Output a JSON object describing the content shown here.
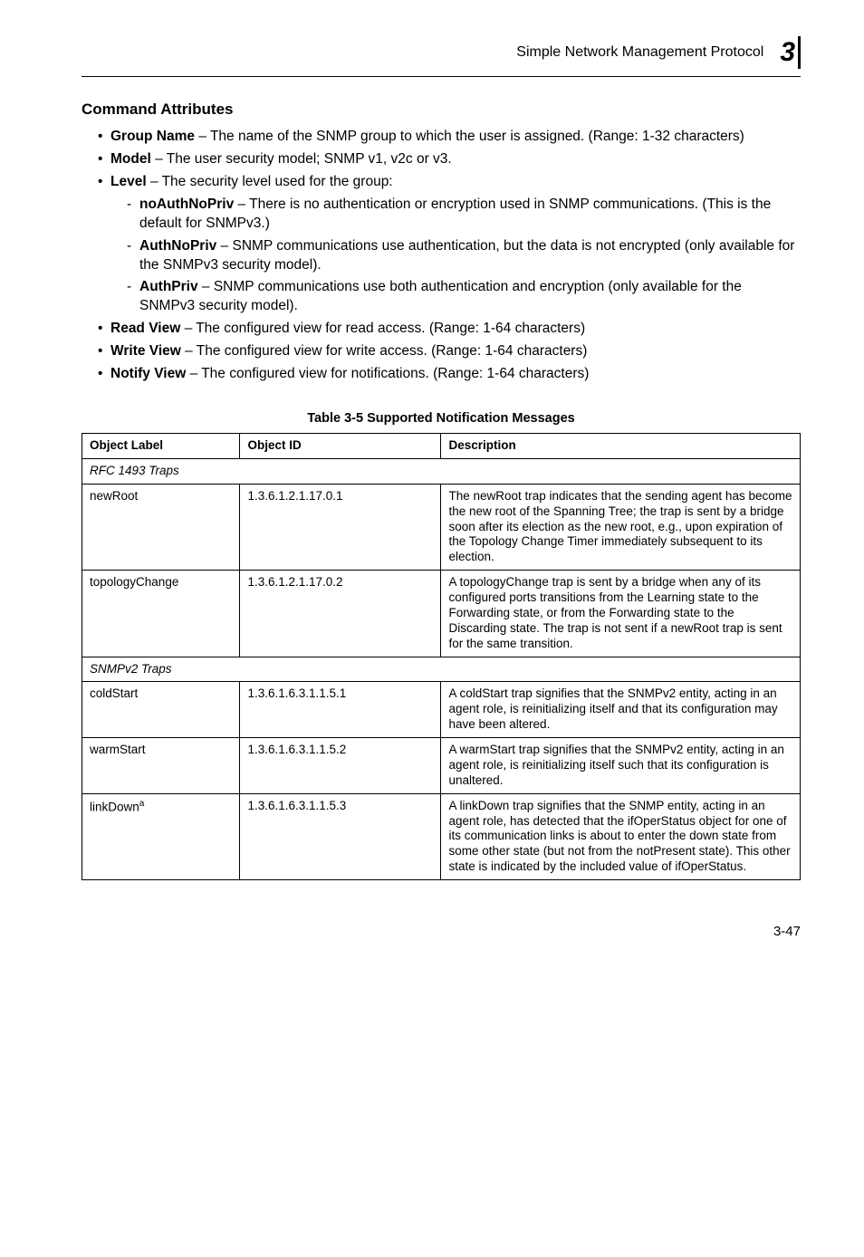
{
  "header": {
    "title": "Simple Network Management Protocol",
    "chapter": "3"
  },
  "section_heading": "Command Attributes",
  "bullets": {
    "group_name_label": "Group Name",
    "group_name_text": " – The name of the SNMP group to which the user is assigned. (Range: 1-32 characters)",
    "model_label": "Model",
    "model_text": " – The user security model; SNMP v1, v2c or v3.",
    "level_label": "Level",
    "level_text": " – The security level used for the group:",
    "noauth_label": "noAuthNoPriv",
    "noauth_text": " – There is no authentication or encryption used in SNMP communications. (This is the default for SNMPv3.)",
    "authno_label": "AuthNoPriv",
    "authno_text": " – SNMP communications use authentication, but the data is not encrypted (only available for the SNMPv3 security model).",
    "authpriv_label": "AuthPriv",
    "authpriv_text": " – SNMP communications use both authentication and encryption (only available for the SNMPv3 security model).",
    "readview_label": "Read View",
    "readview_text": " – The configured view for read access. (Range: 1-64 characters)",
    "writeview_label": "Write View",
    "writeview_text": " – The configured view for write access. (Range: 1-64 characters)",
    "notifyview_label": "Notify View",
    "notifyview_text": " – The configured view for notifications. (Range: 1-64 characters)"
  },
  "table": {
    "caption": "Table 3-5  Supported Notification Messages",
    "headers": {
      "label": "Object Label",
      "id": "Object ID",
      "desc": "Description"
    },
    "section1": "RFC 1493 Traps",
    "rows1": [
      {
        "label": "newRoot",
        "id": "1.3.6.1.2.1.17.0.1",
        "desc": "The newRoot trap indicates that the sending agent has become the new root of the Spanning Tree; the trap is sent by a bridge soon after its election as the new root, e.g., upon expiration of the Topology Change Timer immediately subsequent to its election."
      },
      {
        "label": "topologyChange",
        "id": "1.3.6.1.2.1.17.0.2",
        "desc": "A topologyChange trap is sent by a bridge when any of its configured ports transitions from the Learning state to the Forwarding state, or from the Forwarding state to the Discarding state. The trap is not sent if a newRoot trap is sent for the same transition."
      }
    ],
    "section2": "SNMPv2 Traps",
    "rows2": [
      {
        "label": "coldStart",
        "id": "1.3.6.1.6.3.1.1.5.1",
        "desc": "A coldStart trap signifies that the SNMPv2 entity, acting in an agent role, is reinitializing itself and that its configuration may have been altered."
      },
      {
        "label": "warmStart",
        "id": "1.3.6.1.6.3.1.1.5.2",
        "desc": "A warmStart trap signifies that the SNMPv2 entity, acting in an agent role, is reinitializing itself such that its configuration is unaltered."
      },
      {
        "label_prefix": "linkDown",
        "label_sup": "a",
        "id": "1.3.6.1.6.3.1.1.5.3",
        "desc": "A linkDown trap signifies that the SNMP entity, acting in an agent role, has detected that the ifOperStatus object for one of its communication links is about to enter the down state from some other state (but not from the notPresent state). This other state is indicated by the included value of ifOperStatus."
      }
    ]
  },
  "page_number": "3-47",
  "chart_data": {
    "type": "table",
    "title": "Table 3-5 Supported Notification Messages",
    "columns": [
      "Object Label",
      "Object ID",
      "Description"
    ],
    "sections": [
      {
        "name": "RFC 1493 Traps",
        "rows": [
          [
            "newRoot",
            "1.3.6.1.2.1.17.0.1",
            "The newRoot trap indicates that the sending agent has become the new root of the Spanning Tree; the trap is sent by a bridge soon after its election as the new root, e.g., upon expiration of the Topology Change Timer immediately subsequent to its election."
          ],
          [
            "topologyChange",
            "1.3.6.1.2.1.17.0.2",
            "A topologyChange trap is sent by a bridge when any of its configured ports transitions from the Learning state to the Forwarding state, or from the Forwarding state to the Discarding state. The trap is not sent if a newRoot trap is sent for the same transition."
          ]
        ]
      },
      {
        "name": "SNMPv2 Traps",
        "rows": [
          [
            "coldStart",
            "1.3.6.1.6.3.1.1.5.1",
            "A coldStart trap signifies that the SNMPv2 entity, acting in an agent role, is reinitializing itself and that its configuration may have been altered."
          ],
          [
            "warmStart",
            "1.3.6.1.6.3.1.1.5.2",
            "A warmStart trap signifies that the SNMPv2 entity, acting in an agent role, is reinitializing itself such that its configuration is unaltered."
          ],
          [
            "linkDown",
            "1.3.6.1.6.3.1.1.5.3",
            "A linkDown trap signifies that the SNMP entity, acting in an agent role, has detected that the ifOperStatus object for one of its communication links is about to enter the down state from some other state (but not from the notPresent state). This other state is indicated by the included value of ifOperStatus."
          ]
        ]
      }
    ]
  }
}
